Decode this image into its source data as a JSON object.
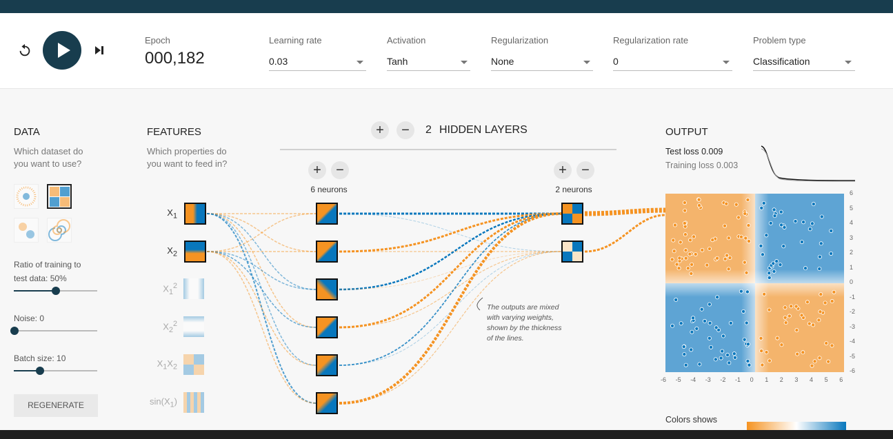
{
  "controls": {
    "epoch_label": "Epoch",
    "epoch_value": "000,182",
    "learning_rate": {
      "label": "Learning rate",
      "value": "0.03"
    },
    "activation": {
      "label": "Activation",
      "value": "Tanh"
    },
    "regularization": {
      "label": "Regularization",
      "value": "None"
    },
    "regularization_rate": {
      "label": "Regularization rate",
      "value": "0"
    },
    "problem_type": {
      "label": "Problem type",
      "value": "Classification"
    }
  },
  "data": {
    "title": "DATA",
    "subtitle_1": "Which dataset do",
    "subtitle_2": "you want to use?",
    "ratio_label": "Ratio of training to",
    "ratio_label_2": "test data:  50%",
    "noise_label": "Noise:  0",
    "batch_label": "Batch size:  10",
    "regenerate": "REGENERATE",
    "ratio_value": 0.5,
    "noise_value": 0,
    "batch_value": 10
  },
  "features": {
    "title": "FEATURES",
    "subtitle_1": "Which properties do",
    "subtitle_2": "you want to feed in?",
    "items": [
      {
        "base": "X",
        "sub": "1",
        "sup": ""
      },
      {
        "base": "X",
        "sub": "2",
        "sup": ""
      },
      {
        "base": "X",
        "sub": "1",
        "sup": "2"
      },
      {
        "base": "X",
        "sub": "2",
        "sup": "2"
      },
      {
        "base": "X",
        "sub": "1",
        "sup": "",
        "base2": "X",
        "sub2": "2"
      },
      {
        "base": "sin(X",
        "sub": "1",
        "sup": "",
        "tail": ")"
      }
    ]
  },
  "network": {
    "hidden_layers_count": "2",
    "hidden_layers_label": "HIDDEN LAYERS",
    "layer1_neurons": "6 neurons",
    "layer2_neurons": "2 neurons",
    "note": "The outputs are mixed with varying weights, shown by the thickness of the lines."
  },
  "output": {
    "title": "OUTPUT",
    "test_loss": "Test loss 0.009",
    "training_loss": "Training loss 0.003",
    "colors_shows": "Colors shows",
    "y_ticks": [
      "6",
      "5",
      "4",
      "3",
      "2",
      "1",
      "0",
      "-1",
      "-2",
      "-3",
      "-4",
      "-5",
      "-6"
    ],
    "x_ticks": [
      "-6",
      "-5",
      "-4",
      "-3",
      "-2",
      "-1",
      "0",
      "1",
      "2",
      "3",
      "4",
      "5",
      "6"
    ]
  },
  "colors": {
    "orange": "#f59322",
    "blue": "#0877bd",
    "dark": "#183d4e"
  }
}
